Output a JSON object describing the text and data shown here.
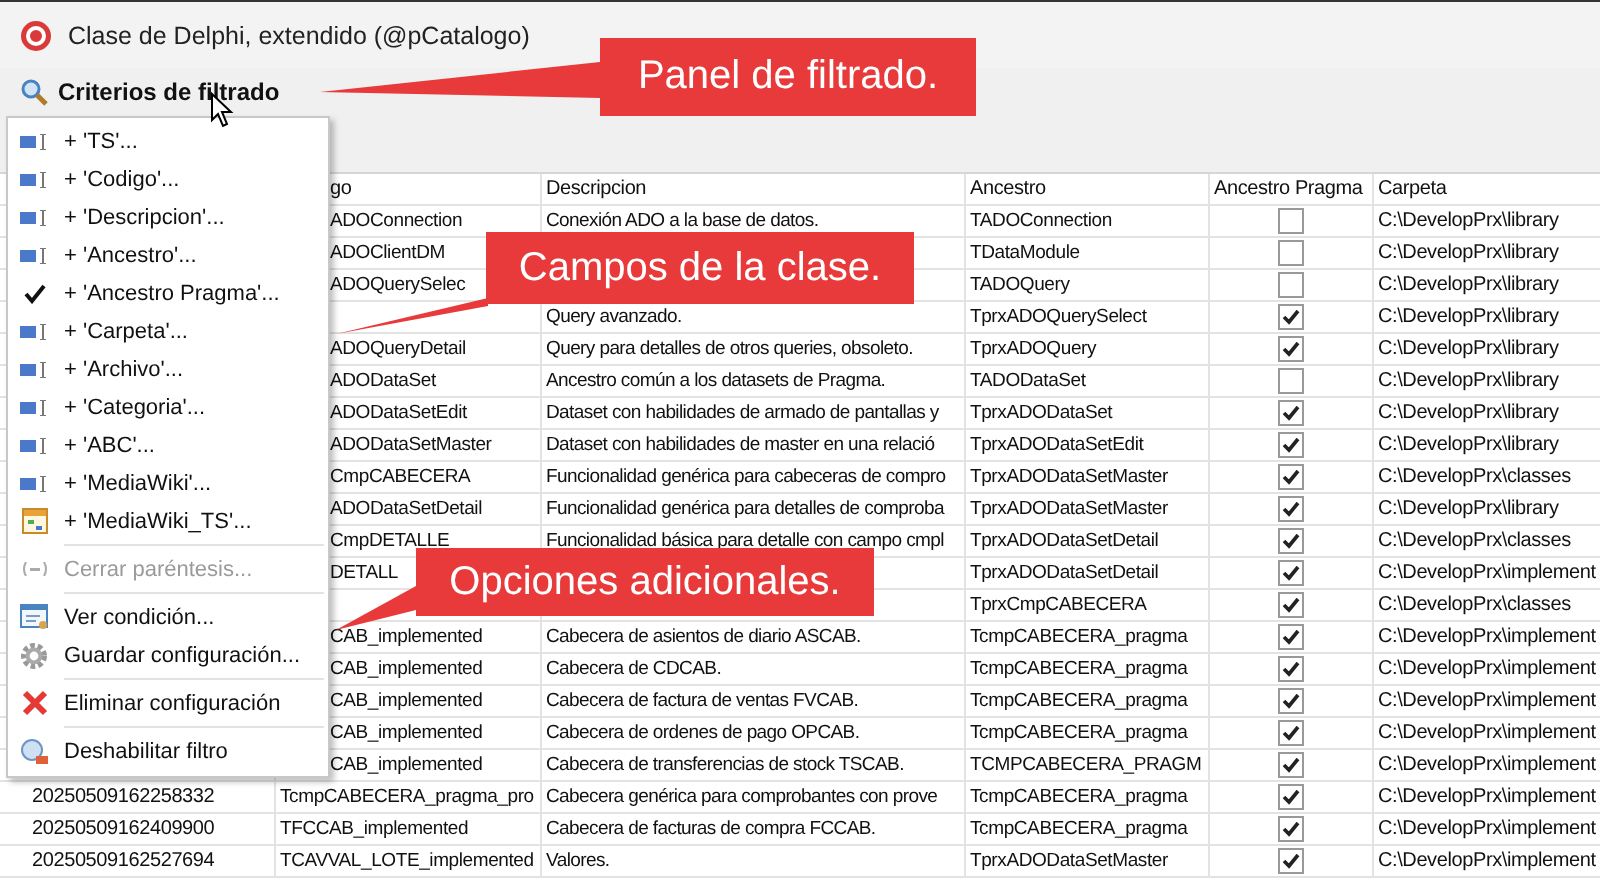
{
  "window": {
    "title": "Clase de Delphi, extendido (@pCatalogo)"
  },
  "toolbar": {
    "label": "Criterios de filtrado"
  },
  "table": {
    "columns": [
      "go",
      "Descripcion",
      "Ancestro",
      "Ancestro Pragma",
      "Carpeta"
    ],
    "rows": [
      {
        "codigo": "ADOConnection",
        "descripcion": "Conexión ADO a la base de datos.",
        "ancestro": "TADOConnection",
        "pragma": false,
        "carpeta": "C:\\DevelopPrx\\library"
      },
      {
        "codigo": "ADOClientDM",
        "ancestro": "TDataModule",
        "pragma": false,
        "carpeta": "C:\\DevelopPrx\\library"
      },
      {
        "codigo": "ADOQuerySelec",
        "ancestro": "TADOQuery",
        "pragma": false,
        "carpeta": "C:\\DevelopPrx\\library"
      },
      {
        "descripcion": "Query avanzado.",
        "ancestro": "TprxADOQuerySelect",
        "pragma": true,
        "carpeta": "C:\\DevelopPrx\\library"
      },
      {
        "codigo": "ADOQueryDetail",
        "descripcion": "Query para detalles de otros queries, obsoleto.",
        "ancestro": "TprxADOQuery",
        "pragma": true,
        "carpeta": "C:\\DevelopPrx\\library"
      },
      {
        "codigo": "ADODataSet",
        "descripcion": "Ancestro común a los datasets de Pragma.",
        "ancestro": "TADODataSet",
        "pragma": false,
        "carpeta": "C:\\DevelopPrx\\library"
      },
      {
        "codigo": "ADODataSetEdit",
        "descripcion": "Dataset con habilidades de armado de pantallas y",
        "ancestro": "TprxADODataSet",
        "pragma": true,
        "carpeta": "C:\\DevelopPrx\\library"
      },
      {
        "codigo": "ADODataSetMaster",
        "descripcion": "Dataset con habilidades de master en una relació",
        "ancestro": "TprxADODataSetEdit",
        "pragma": true,
        "carpeta": "C:\\DevelopPrx\\library"
      },
      {
        "codigo": "CmpCABECERA",
        "descripcion": "Funcionalidad genérica para cabeceras de compro",
        "ancestro": "TprxADODataSetMaster",
        "pragma": true,
        "carpeta": "C:\\DevelopPrx\\classes"
      },
      {
        "codigo": "ADODataSetDetail",
        "descripcion": "Funcionalidad genérica para detalles de comproba",
        "ancestro": "TprxADODataSetMaster",
        "pragma": true,
        "carpeta": "C:\\DevelopPrx\\library"
      },
      {
        "codigo": "CmpDETALLE",
        "descripcion": "Funcionalidad básica para detalle con campo cmpl",
        "ancestro": "TprxADODataSetDetail",
        "pragma": true,
        "carpeta": "C:\\DevelopPrx\\classes"
      },
      {
        "codigo": "DETALL",
        "ancestro": "TprxADODataSetDetail",
        "pragma": true,
        "carpeta": "C:\\DevelopPrx\\implement"
      },
      {
        "ancestro": "TprxCmpCABECERA",
        "pragma": true,
        "carpeta": "C:\\DevelopPrx\\classes"
      },
      {
        "codigo": "CAB_implemented",
        "descripcion": "Cabecera de asientos de diario ASCAB.",
        "ancestro": "TcmpCABECERA_pragma",
        "pragma": true,
        "carpeta": "C:\\DevelopPrx\\implement"
      },
      {
        "codigo": "CAB_implemented",
        "descripcion": "Cabecera de CDCAB.",
        "ancestro": "TcmpCABECERA_pragma",
        "pragma": true,
        "carpeta": "C:\\DevelopPrx\\implement"
      },
      {
        "codigo": "CAB_implemented",
        "descripcion": "Cabecera de factura de ventas FVCAB.",
        "ancestro": "TcmpCABECERA_pragma",
        "pragma": true,
        "carpeta": "C:\\DevelopPrx\\implement"
      },
      {
        "codigo": "CAB_implemented",
        "descripcion": "Cabecera de ordenes de pago OPCAB.",
        "ancestro": "TcmpCABECERA_pragma",
        "pragma": true,
        "carpeta": "C:\\DevelopPrx\\implement"
      },
      {
        "codigo": "CAB_implemented",
        "descripcion": "Cabecera de transferencias de stock TSCAB.",
        "ancestro": "TCMPCABECERA_PRAGM",
        "pragma": true,
        "carpeta": "C:\\DevelopPrx\\implement"
      },
      {
        "ts": "20250509162258332",
        "codigo": "TcmpCABECERA_pragma_pro",
        "descripcion": "Cabecera genérica para comprobantes con prove",
        "ancestro": "TcmpCABECERA_pragma",
        "pragma": true,
        "carpeta": "C:\\DevelopPrx\\implement"
      },
      {
        "ts": "20250509162409900",
        "codigo": "TFCCAB_implemented",
        "descripcion": "Cabecera de facturas de compra FCCAB.",
        "ancestro": "TcmpCABECERA_pragma",
        "pragma": true,
        "carpeta": "C:\\DevelopPrx\\implement"
      },
      {
        "ts": "20250509162527694",
        "codigo": "TCAVVAL_LOTE_implemented",
        "descripcion": "Valores.",
        "ancestro": "TprxADODataSetMaster",
        "pragma": true,
        "carpeta": "C:\\DevelopPrx\\implement"
      }
    ]
  },
  "menu": {
    "groups": [
      [
        {
          "kind": "field",
          "label": "+ 'TS'...",
          "disabled": false
        },
        {
          "kind": "field",
          "label": "+ 'Codigo'...",
          "disabled": false
        },
        {
          "kind": "field",
          "label": "+ 'Descripcion'...",
          "disabled": false
        },
        {
          "kind": "field",
          "label": "+ 'Ancestro'...",
          "disabled": false
        },
        {
          "kind": "check",
          "label": "+ 'Ancestro Pragma'...",
          "disabled": false
        },
        {
          "kind": "field",
          "label": "+ 'Carpeta'...",
          "disabled": false
        },
        {
          "kind": "field",
          "label": "+ 'Archivo'...",
          "disabled": false
        },
        {
          "kind": "field",
          "label": "+ 'Categoria'...",
          "disabled": false
        },
        {
          "kind": "field",
          "label": "+ 'ABC'...",
          "disabled": false
        },
        {
          "kind": "field",
          "label": "+ 'MediaWiki'...",
          "disabled": false
        },
        {
          "kind": "table",
          "label": "+ 'MediaWiki_TS'...",
          "disabled": false
        }
      ],
      [
        {
          "kind": "paren",
          "label": "Cerrar paréntesis...",
          "disabled": true
        }
      ],
      [
        {
          "kind": "view",
          "label": "Ver condición...",
          "disabled": false
        },
        {
          "kind": "gear",
          "label": "Guardar configuración...",
          "disabled": false
        }
      ],
      [
        {
          "kind": "delete",
          "label": "Eliminar configuración",
          "disabled": false
        }
      ],
      [
        {
          "kind": "disable",
          "label": "Deshabilitar filtro",
          "disabled": false
        }
      ]
    ]
  },
  "callouts": [
    "Panel de filtrado.",
    "Campos de la clase.",
    "Opciones adicionales."
  ]
}
